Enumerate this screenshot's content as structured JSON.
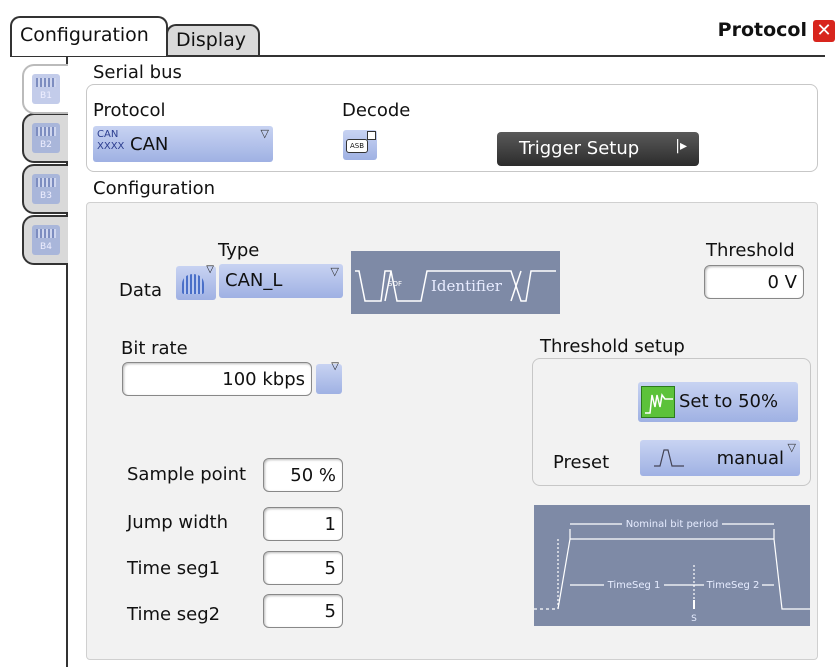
{
  "tabs": [
    {
      "label": "Configuration"
    },
    {
      "label": "Display"
    }
  ],
  "panel_title": "Protocol",
  "side_tabs": [
    "B1",
    "B2",
    "B3",
    "B4"
  ],
  "serial_bus": {
    "heading": "Serial bus",
    "protocol_label": "Protocol",
    "protocol_icon": "CAN\nXXXX",
    "protocol_value": "CAN",
    "decode_label": "Decode",
    "decode_icon": "ASB",
    "trigger_setup": "Trigger Setup"
  },
  "configuration": {
    "heading": "Configuration",
    "type_label": "Type",
    "data_label": "Data",
    "data_type_value": "CAN_L",
    "identifier_label": "Identifier",
    "sof_label": "SOF",
    "threshold_label": "Threshold",
    "threshold_value": "0 V",
    "bit_rate_label": "Bit rate",
    "bit_rate_value": "100 kbps",
    "threshold_setup_label": "Threshold setup",
    "set50_label": "Set to 50%",
    "preset_label": "Preset",
    "preset_value": "manual",
    "sample_point_label": "Sample point",
    "sample_point_value": "50 %",
    "jump_width_label": "Jump width",
    "jump_width_value": "1",
    "time_seg1_label": "Time seg1",
    "time_seg1_value": "5",
    "time_seg2_label": "Time seg2",
    "time_seg2_value": "5",
    "timing_diagram": {
      "nominal": "Nominal bit period",
      "tseg1": "TimeSeg 1",
      "tseg2": "TimeSeg 2",
      "s_label": "S"
    }
  },
  "colors": {
    "accent_blue": "#a9b8e6",
    "close_red": "#d8251d",
    "diagram_bg": "#7e8aa6",
    "set50_green": "#5cc23a"
  }
}
